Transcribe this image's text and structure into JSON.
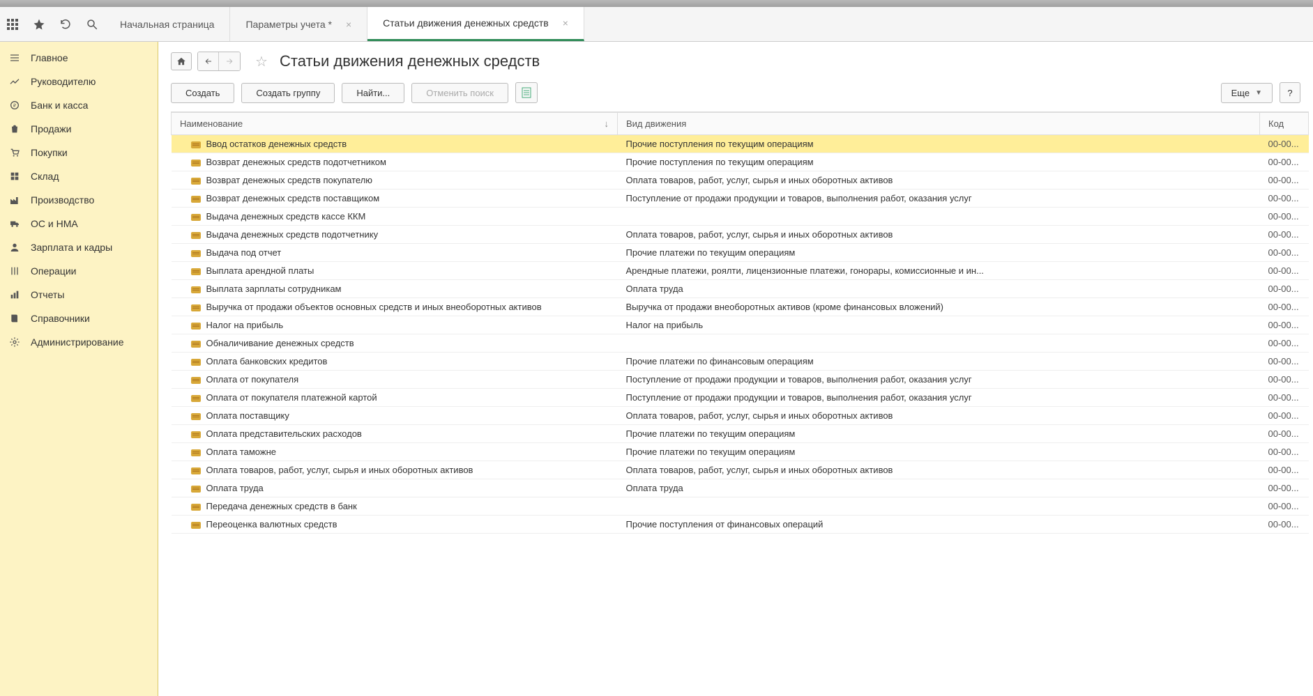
{
  "tabs": [
    {
      "label": "Начальная страница",
      "closable": false,
      "active": false
    },
    {
      "label": "Параметры учета *",
      "closable": true,
      "active": false
    },
    {
      "label": "Статьи движения денежных средств",
      "closable": true,
      "active": true
    }
  ],
  "sidebar": [
    {
      "icon": "menu",
      "label": "Главное"
    },
    {
      "icon": "trend",
      "label": "Руководителю"
    },
    {
      "icon": "coin",
      "label": "Банк и касса"
    },
    {
      "icon": "bag",
      "label": "Продажи"
    },
    {
      "icon": "cart",
      "label": "Покупки"
    },
    {
      "icon": "boxes",
      "label": "Склад"
    },
    {
      "icon": "factory",
      "label": "Производство"
    },
    {
      "icon": "truck",
      "label": "ОС и НМА"
    },
    {
      "icon": "person",
      "label": "Зарплата и кадры"
    },
    {
      "icon": "ops",
      "label": "Операции"
    },
    {
      "icon": "chart",
      "label": "Отчеты"
    },
    {
      "icon": "book",
      "label": "Справочники"
    },
    {
      "icon": "gear",
      "label": "Администрирование"
    }
  ],
  "page": {
    "title": "Статьи движения денежных средств"
  },
  "toolbar": {
    "create": "Создать",
    "create_group": "Создать группу",
    "find": "Найти...",
    "cancel_search": "Отменить поиск",
    "more": "Еще",
    "help": "?"
  },
  "columns": {
    "name": "Наименование",
    "type": "Вид движения",
    "code": "Код"
  },
  "rows": [
    {
      "name": "Ввод остатков денежных средств",
      "type": "Прочие поступления по текущим операциям",
      "code": "00-00...",
      "selected": true
    },
    {
      "name": "Возврат денежных средств подотчетником",
      "type": "Прочие поступления по текущим операциям",
      "code": "00-00..."
    },
    {
      "name": "Возврат денежных средств покупателю",
      "type": "Оплата товаров, работ, услуг, сырья и иных оборотных активов",
      "code": "00-00..."
    },
    {
      "name": "Возврат денежных средств поставщиком",
      "type": "Поступление от продажи продукции и товаров, выполнения работ, оказания услуг",
      "code": "00-00..."
    },
    {
      "name": "Выдача денежных средств кассе ККМ",
      "type": "",
      "code": "00-00..."
    },
    {
      "name": "Выдача денежных средств подотчетнику",
      "type": "Оплата товаров, работ, услуг, сырья и иных оборотных активов",
      "code": "00-00..."
    },
    {
      "name": "Выдача под отчет",
      "type": "Прочие платежи по текущим операциям",
      "code": "00-00..."
    },
    {
      "name": "Выплата арендной платы",
      "type": "Арендные платежи, роялти, лицензионные платежи, гонорары, комиссионные и ин...",
      "code": "00-00..."
    },
    {
      "name": "Выплата зарплаты сотрудникам",
      "type": "Оплата труда",
      "code": "00-00..."
    },
    {
      "name": "Выручка от продажи объектов основных средств и иных внеоборотных активов",
      "type": "Выручка от продажи внеоборотных активов (кроме финансовых вложений)",
      "code": "00-00..."
    },
    {
      "name": "Налог на прибыль",
      "type": "Налог на прибыль",
      "code": "00-00..."
    },
    {
      "name": "Обналичивание денежных средств",
      "type": "",
      "code": "00-00..."
    },
    {
      "name": "Оплата банковских кредитов",
      "type": "Прочие платежи по финансовым операциям",
      "code": "00-00..."
    },
    {
      "name": "Оплата от покупателя",
      "type": "Поступление от продажи продукции и товаров, выполнения работ, оказания услуг",
      "code": "00-00..."
    },
    {
      "name": "Оплата от покупателя платежной картой",
      "type": "Поступление от продажи продукции и товаров, выполнения работ, оказания услуг",
      "code": "00-00..."
    },
    {
      "name": "Оплата поставщику",
      "type": "Оплата товаров, работ, услуг, сырья и иных оборотных активов",
      "code": "00-00..."
    },
    {
      "name": "Оплата представительских расходов",
      "type": "Прочие платежи по текущим операциям",
      "code": "00-00..."
    },
    {
      "name": "Оплата таможне",
      "type": "Прочие платежи по текущим операциям",
      "code": "00-00..."
    },
    {
      "name": "Оплата товаров, работ, услуг, сырья и иных оборотных активов",
      "type": "Оплата товаров, работ, услуг, сырья и иных оборотных активов",
      "code": "00-00..."
    },
    {
      "name": "Оплата труда",
      "type": "Оплата труда",
      "code": "00-00..."
    },
    {
      "name": "Передача денежных средств в банк",
      "type": "",
      "code": "00-00..."
    },
    {
      "name": "Переоценка валютных средств",
      "type": "Прочие поступления от финансовых операций",
      "code": "00-00..."
    }
  ]
}
